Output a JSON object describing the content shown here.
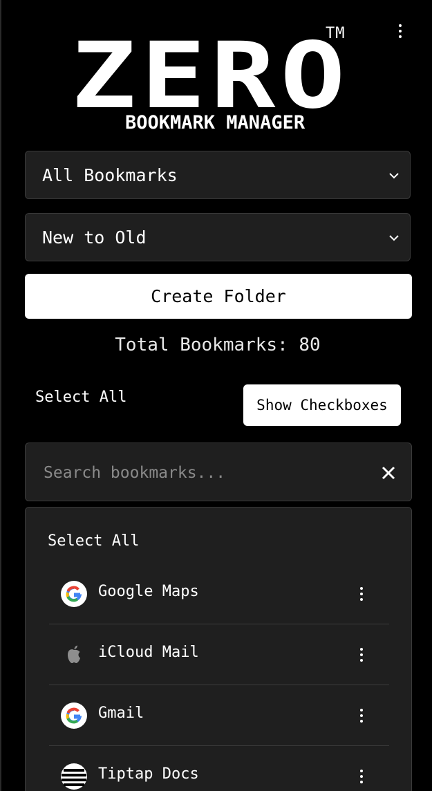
{
  "logo": {
    "main": "ZERO",
    "tm": "TM",
    "sub": "BOOKMARK MANAGER"
  },
  "filters": {
    "folder_select": "All Bookmarks",
    "sort_select": "New to Old"
  },
  "actions": {
    "create_folder": "Create Folder",
    "select_all": "Select All",
    "show_checkboxes": "Show Checkboxes"
  },
  "stats": {
    "total_label": "Total Bookmarks: 80"
  },
  "search": {
    "placeholder": "Search bookmarks..."
  },
  "list": {
    "select_all": "Select All",
    "items": [
      {
        "label": "Google Maps",
        "icon": "google-icon"
      },
      {
        "label": "iCloud Mail",
        "icon": "apple-icon"
      },
      {
        "label": "Gmail",
        "icon": "google-icon"
      },
      {
        "label": "Tiptap Docs",
        "icon": "tiptap-icon"
      }
    ]
  }
}
